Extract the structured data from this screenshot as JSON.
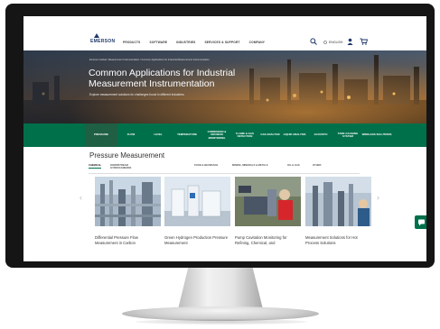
{
  "header": {
    "logo_text": "EMERSON",
    "nav": [
      "PRODUCTS",
      "SOFTWARE",
      "INDUSTRIES",
      "SERVICES & SUPPORT",
      "COMPANY"
    ],
    "language": "ENGLISH"
  },
  "hero": {
    "breadcrumb": "Emerson Global  /  Measurement Instrumentation  /  Common Applications for Industrial Measurement Instrumentation",
    "title": "Common Applications for Industrial Measurement Instrumentation",
    "subtitle": "Explore measurement solutions for challenges found in different industries."
  },
  "categories": [
    {
      "label": "PRESSURE",
      "active": true
    },
    {
      "label": "FLOW",
      "active": false
    },
    {
      "label": "LEVEL",
      "active": false
    },
    {
      "label": "TEMPERATURE",
      "active": false
    },
    {
      "label": "CORROSION & EROSION MONITORING",
      "active": false
    },
    {
      "label": "FLAME & GAS DETECTION",
      "active": false
    },
    {
      "label": "GAS ANALYSIS",
      "active": false
    },
    {
      "label": "LIQUID ANALYSIS",
      "active": false
    },
    {
      "label": "ACOUSTIC",
      "active": false
    },
    {
      "label": "TANK GAUGING SYSTEM",
      "active": false
    },
    {
      "label": "WIRELESS SOLUTIONS",
      "active": false
    }
  ],
  "section": {
    "title": "Pressure Measurement",
    "tabs": [
      "CHEMICAL",
      "DOWNSTREAM HYDROCARBONS",
      "FOOD & BEVERAGE",
      "MINING, MINERALS & METALS",
      "OIL & GAS",
      "OTHER"
    ],
    "active_tab": "CHEMICAL"
  },
  "cards": [
    {
      "title": "Differential Pressure Flow Measurement in Carbon"
    },
    {
      "title": "Green Hydrogen Production Pressure Measurement"
    },
    {
      "title": "Pump Cavitation Monitoring for Refining, Chemical, and"
    },
    {
      "title": "Measurement Solutions for Hot Process Solutions"
    }
  ],
  "carousel": {
    "prev": "‹",
    "next": "›"
  },
  "colors": {
    "brand_green": "#00704a",
    "logo_blue": "#1f3a6b"
  }
}
